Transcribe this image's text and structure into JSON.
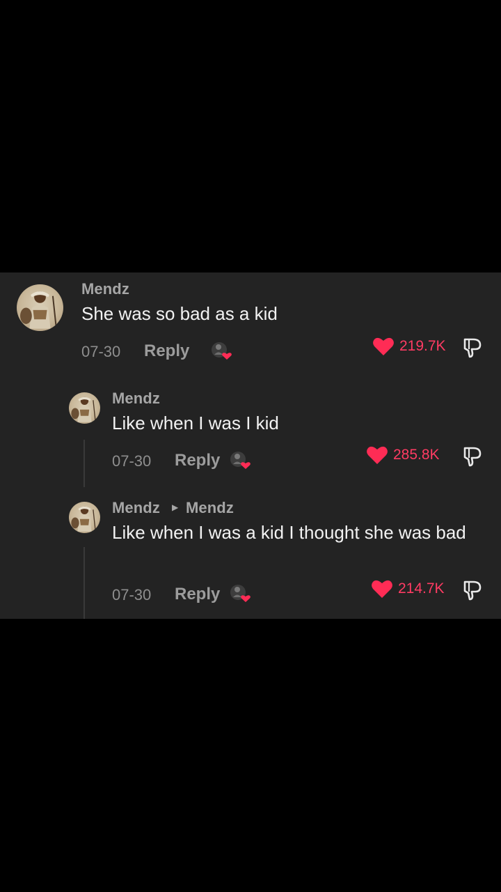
{
  "comments": [
    {
      "username": "Mendz",
      "text": "She was so bad as a kid",
      "date": "07-30",
      "reply_label": "Reply",
      "likes": "219.7K"
    },
    {
      "username": "Mendz",
      "text": "Like when I was I kid",
      "date": "07-30",
      "reply_label": "Reply",
      "likes": "285.8K"
    },
    {
      "username": "Mendz",
      "reply_to": "Mendz",
      "text": "Like when I was a kid I thought she was bad",
      "date": "07-30",
      "reply_label": "Reply",
      "likes": "214.7K"
    }
  ],
  "colors": {
    "panel_bg": "#232323",
    "like_accent": "#ff2c55",
    "username": "#a6a6a6",
    "text": "#f2f2f2"
  },
  "icons": [
    "heart-icon",
    "dislike-icon",
    "creator-liked-icon",
    "caret-right-icon"
  ]
}
